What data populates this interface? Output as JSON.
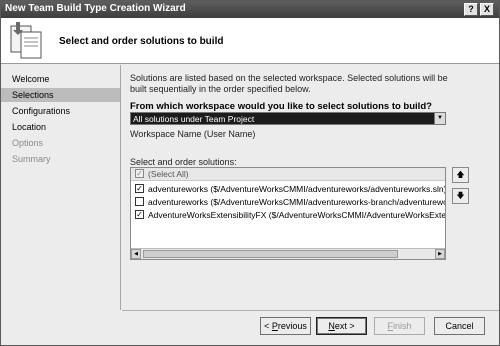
{
  "window": {
    "title": "New Team Build Type Creation Wizard",
    "help_glyph": "?",
    "close_glyph": "X"
  },
  "header": {
    "heading": "Select and order solutions to build",
    "icon": "wizard-document-icon"
  },
  "sidebar": {
    "items": [
      {
        "label": "Welcome",
        "state": "normal"
      },
      {
        "label": "Selections",
        "state": "selected"
      },
      {
        "label": "Configurations",
        "state": "normal"
      },
      {
        "label": "Location",
        "state": "normal"
      },
      {
        "label": "Options",
        "state": "disabled"
      },
      {
        "label": "Summary",
        "state": "disabled"
      }
    ]
  },
  "main": {
    "intro": "Solutions are listed based on the selected workspace. Selected solutions will be built sequentially in the order specified below.",
    "workspace_question": "From which workspace would you like to select solutions to build?",
    "workspace_combo_value": "All solutions under Team Project",
    "workspace_name_label": "Workspace Name (User Name)",
    "solutions_label": "Select and order solutions:",
    "select_all_label": "(Select All)",
    "solutions": [
      {
        "checked": true,
        "text": "adventureworks ($/AdventureWorksCMMI/adventureworks/adventureworks.sln)"
      },
      {
        "checked": false,
        "text": "adventureworks ($/AdventureWorksCMMI/adventureworks-branch/adventureworks.sln)"
      },
      {
        "checked": true,
        "text": "AdventureWorksExtensibilityFX ($/AdventureWorksCMMI/AdventureWorksExtensibilityFX/AdventureWorksExtensibilityFX.sln)"
      }
    ],
    "move_up_icon": "arrow-up-icon",
    "move_down_icon": "arrow-down-icon"
  },
  "footer": {
    "previous_pre": "< ",
    "previous_ul": "P",
    "previous_post": "revious",
    "next_ul": "N",
    "next_post": "ext >",
    "finish_ul": "F",
    "finish_post": "inish",
    "cancel": "Cancel"
  },
  "colors": {
    "titlebar": "#4a4a4a",
    "selected_sidebar": "#bcbcbc",
    "combo_background": "#1c1c1c"
  }
}
